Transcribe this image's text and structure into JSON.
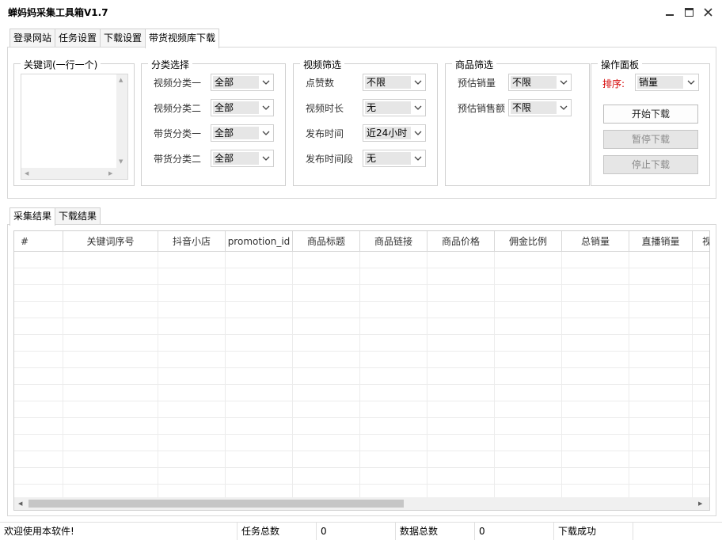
{
  "window": {
    "title": "蝉妈妈采集工具箱V1.7"
  },
  "main_tabs": [
    {
      "label": "登录网站",
      "active": false
    },
    {
      "label": "任务设置",
      "active": false
    },
    {
      "label": "下载设置",
      "active": false
    },
    {
      "label": "带货视频库下载",
      "active": true
    }
  ],
  "keywords": {
    "legend": "关键词(一行一个)",
    "value": ""
  },
  "category": {
    "legend": "分类选择",
    "fields": [
      {
        "label": "视频分类一",
        "value": "全部"
      },
      {
        "label": "视频分类二",
        "value": "全部"
      },
      {
        "label": "带货分类一",
        "value": "全部"
      },
      {
        "label": "带货分类二",
        "value": "全部"
      }
    ]
  },
  "video_filter": {
    "legend": "视频筛选",
    "fields": [
      {
        "label": "点赞数",
        "value": "不限"
      },
      {
        "label": "视频时长",
        "value": "无"
      },
      {
        "label": "发布时间",
        "value": "近24小时"
      },
      {
        "label": "发布时间段",
        "value": "无"
      }
    ]
  },
  "product_filter": {
    "legend": "商品筛选",
    "fields": [
      {
        "label": "预估销量",
        "value": "不限"
      },
      {
        "label": "预估销售额",
        "value": "不限"
      }
    ]
  },
  "operation": {
    "legend": "操作面板",
    "sort_label": "排序:",
    "sort_value": "销量",
    "start_label": "开始下载",
    "pause_label": "暂停下载",
    "stop_label": "停止下载"
  },
  "result_tabs": [
    {
      "label": "采集结果",
      "active": true
    },
    {
      "label": "下载结果",
      "active": false
    }
  ],
  "table": {
    "columns": [
      "#",
      "关键词序号",
      "抖音小店",
      "promotion_id",
      "商品标题",
      "商品链接",
      "商品价格",
      "佣金比例",
      "总销量",
      "直播销量",
      "视"
    ],
    "rows": []
  },
  "status": {
    "welcome": "欢迎使用本软件!",
    "task_total_label": "任务总数",
    "task_total": "0",
    "data_total_label": "数据总数",
    "data_total": "0",
    "download_status": "下载成功"
  },
  "colors": {
    "accent_red": "#d40000",
    "disabled_bg": "#e6e6e6"
  }
}
